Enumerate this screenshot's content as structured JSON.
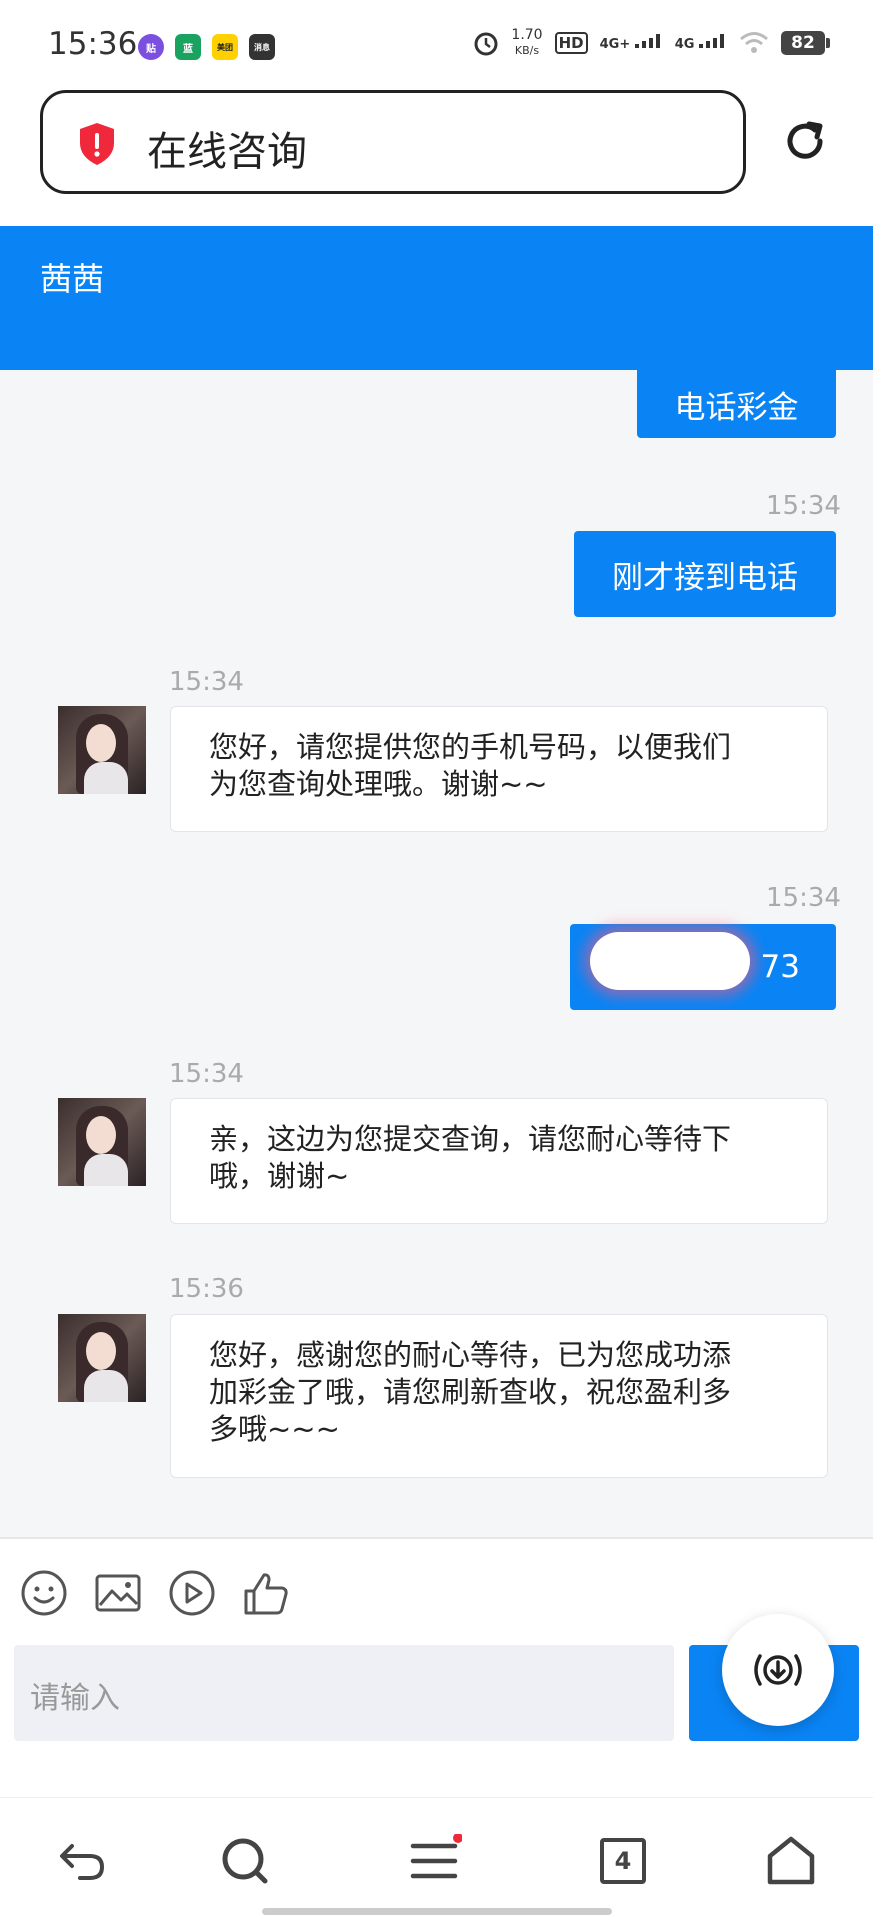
{
  "status_bar": {
    "time": "15:36",
    "app_icons": [
      "贴",
      "蓝",
      "美团",
      "消息"
    ],
    "net_speed_value": "1.70",
    "net_speed_unit": "KB/s",
    "hd_label": "HD",
    "signal_1": "4G+",
    "signal_2": "4G",
    "battery": "82"
  },
  "address_bar": {
    "title": "在线咨询",
    "icon": "shield-alert-icon"
  },
  "header": {
    "agent_name": "茜茜"
  },
  "messages": [
    {
      "direction": "out",
      "text": "电话彩金"
    },
    {
      "direction": "out",
      "time": "15:34",
      "text": "刚才接到电话"
    },
    {
      "direction": "in",
      "time": "15:34",
      "text_lines": [
        "您好，请您提供您的手机号码，以便我们",
        "为您查询处理哦。谢谢~~"
      ]
    },
    {
      "direction": "out",
      "time": "15:34",
      "text": "73",
      "redacted": true
    },
    {
      "direction": "in",
      "time": "15:34",
      "text_lines": [
        "亲，这边为您提交查询，请您耐心等待下",
        "哦，谢谢~"
      ]
    },
    {
      "direction": "in",
      "time": "15:36",
      "text_lines": [
        "您好，感谢您的耐心等待，已为您成功添",
        "加彩金了哦，请您刷新查收，祝您盈利多",
        "多哦~~~"
      ]
    }
  ],
  "composer": {
    "placeholder": "请输入",
    "tools": [
      "emoji-icon",
      "image-icon",
      "video-icon",
      "like-icon"
    ]
  },
  "bottom_nav": {
    "tab_count": "4",
    "items": [
      "back-icon",
      "search-icon",
      "menu-icon",
      "tabs-icon",
      "home-icon"
    ]
  },
  "colors": {
    "accent": "#0a84f5",
    "chat_bg": "#f5f6f8"
  }
}
